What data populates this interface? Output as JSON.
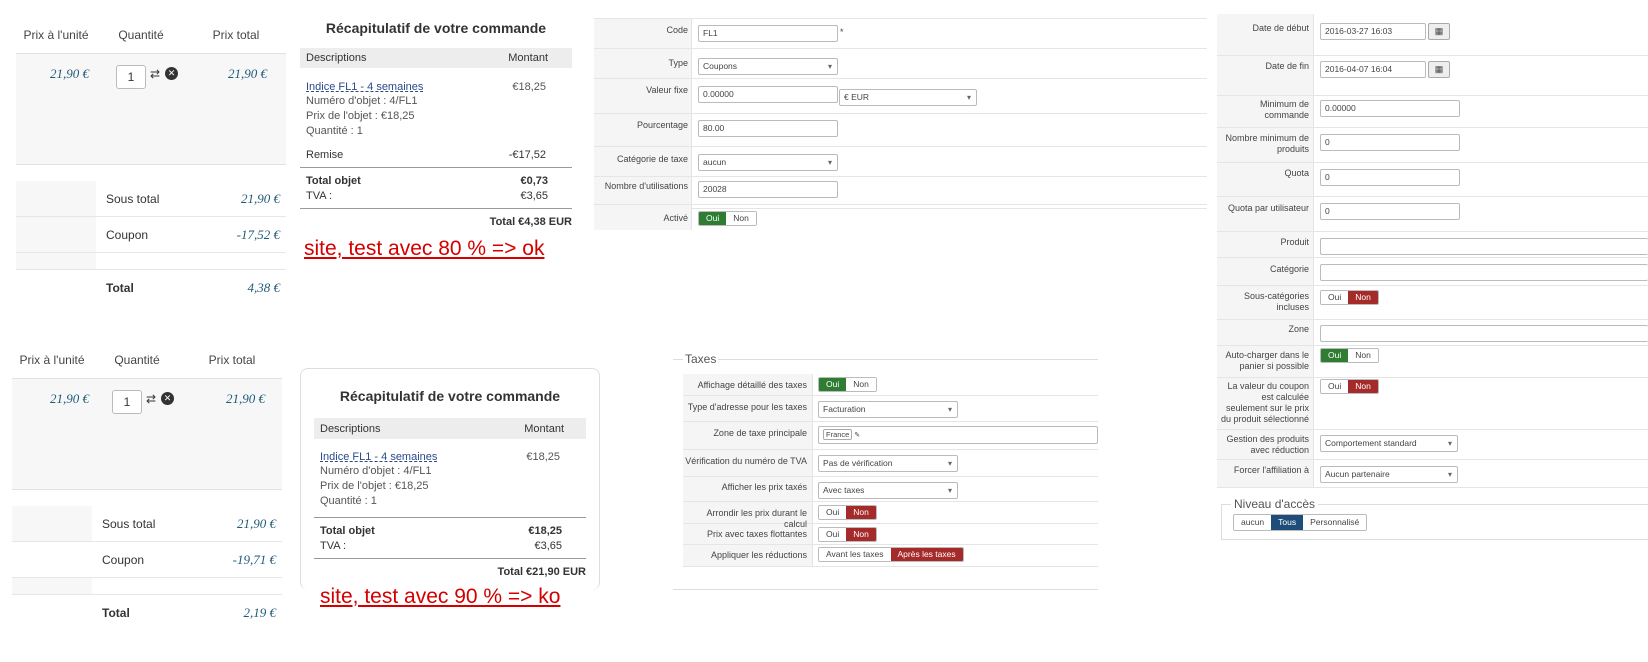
{
  "cart_ok": {
    "headers": [
      "Prix à l'unité",
      "Quantité",
      "Prix total"
    ],
    "unit_price": "21,90 €",
    "quantity": "1",
    "line_total": "21,90 €",
    "subtotal_label": "Sous total",
    "subtotal": "21,90 €",
    "coupon_label": "Coupon",
    "coupon": "-17,52 €",
    "total_label": "Total",
    "total": "4,38 €"
  },
  "cart_ko": {
    "headers": [
      "Prix à l'unité",
      "Quantité",
      "Prix total"
    ],
    "unit_price": "21,90 €",
    "quantity": "1",
    "line_total": "21,90 €",
    "subtotal_label": "Sous total",
    "subtotal": "21,90 €",
    "coupon_label": "Coupon",
    "coupon": "-19,71 €",
    "total_label": "Total",
    "total": "2,19 €"
  },
  "summary_ok": {
    "title": "Récapitulatif de votre commande",
    "col_desc": "Descriptions",
    "col_amount": "Montant",
    "item_link": "Indice FL1 - 4 semaines",
    "item_amount": "€18,25",
    "item_number": "Numéro d'objet : 4/FL1",
    "item_price": "Prix de l'objet : €18,25",
    "item_qty": "Quantité : 1",
    "discount_label": "Remise",
    "discount": "-€17,52",
    "total_obj_label": "Total objet",
    "total_obj": "€0,73",
    "tva_label": "TVA :",
    "tva": "€3,65",
    "grand_total": "Total €4,38 EUR",
    "note": "site, test avec 80 % => ok"
  },
  "summary_ko": {
    "title": "Récapitulatif de votre commande",
    "col_desc": "Descriptions",
    "col_amount": "Montant",
    "item_link": "Indice FL1 - 4 semaines",
    "item_amount": "€18,25",
    "item_number": "Numéro d'objet : 4/FL1",
    "item_price": "Prix de l'objet : €18,25",
    "item_qty": "Quantité : 1",
    "total_obj_label": "Total objet",
    "total_obj": "€18,25",
    "tva_label": "TVA :",
    "tva": "€3,65",
    "grand_total": "Total €21,90 EUR",
    "note": "site, test avec 90 % => ko"
  },
  "coupon_form": {
    "code_label": "Code",
    "code": "FL1",
    "required": "*",
    "type_label": "Type",
    "type": "Coupons",
    "fixed_label": "Valeur fixe",
    "fixed": "0.00000",
    "currency": "€ EUR",
    "percent_label": "Pourcentage",
    "percent": "80.00",
    "taxcat_label": "Catégorie de taxe",
    "taxcat": "aucun",
    "uses_label": "Nombre d'utilisations",
    "uses": "20028",
    "active_label": "Activé",
    "yes": "Oui",
    "no": "Non"
  },
  "taxes_form": {
    "legend": "Taxes",
    "r1_label": "Affichage détaillé des taxes",
    "r2_label": "Type d'adresse pour les taxes",
    "r2": "Facturation",
    "r3_label": "Zone de taxe principale",
    "r3": "France",
    "r4_label": "Vérification du numéro de TVA",
    "r4": "Pas de vérification",
    "r5_label": "Afficher les prix taxés",
    "r5": "Avec taxes",
    "r6_label": "Arrondir les prix durant le calcul",
    "r7_label": "Prix avec taxes flottantes",
    "r8_label": "Appliquer les réductions",
    "r8_a": "Avant les taxes",
    "r8_b": "Après les taxes",
    "yes": "Oui",
    "no": "Non"
  },
  "dates_form": {
    "start_label": "Date de début",
    "start": "2016-03-27 16:03",
    "end_label": "Date de fin",
    "end": "2016-04-07 16:04",
    "min_order_label": "Minimum de commande",
    "min_order": "0.00000",
    "min_products_label": "Nombre minimum de produits",
    "min_products": "0",
    "quota_label": "Quota",
    "quota": "0",
    "quota_user_label": "Quota par utilisateur",
    "quota_user": "0",
    "product_label": "Produit",
    "category_label": "Catégorie",
    "subcat_label": "Sous-catégories incluses",
    "zone_label": "Zone",
    "autoload_label": "Auto-charger dans le panier si possible",
    "coupon_value_label": "La valeur du coupon est calculée seulement sur le prix du produit sélectionné",
    "discount_products_label": "Gestion des produits avec réduction",
    "discount_products": "Comportement standard",
    "affiliation_label": "Forcer l'affiliation à",
    "affiliation": "Aucun partenaire",
    "access_legend": "Niveau d'accès",
    "access_a": "aucun",
    "access_b": "Tous",
    "access_c": "Personnalisé",
    "yes": "Oui",
    "no": "Non"
  }
}
